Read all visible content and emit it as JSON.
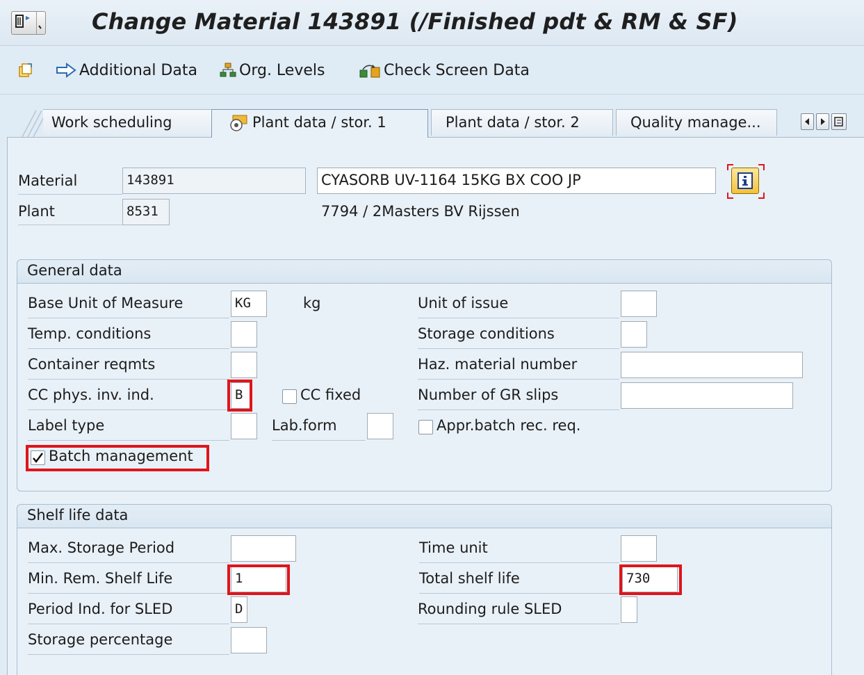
{
  "window": {
    "title": "Change Material 143891 (/Finished pdt & RM & SF)"
  },
  "toolbar": {
    "additional_data": "Additional Data",
    "org_levels": "Org. Levels",
    "check_screen_data": "Check Screen Data"
  },
  "tabs": [
    {
      "label": "Work scheduling",
      "active": false
    },
    {
      "label": "Plant data / stor. 1",
      "active": true
    },
    {
      "label": "Plant data / stor. 2",
      "active": false
    },
    {
      "label": "Quality manage...",
      "active": false
    }
  ],
  "header": {
    "material_label": "Material",
    "material_value": "143891",
    "material_description": "CYASORB UV-1164 15KG BX COO JP",
    "plant_label": "Plant",
    "plant_value": "8531",
    "plant_description": "7794 / 2Masters BV Rijssen"
  },
  "general_data": {
    "title": "General data",
    "base_uom_label": "Base Unit of Measure",
    "base_uom_value": "KG",
    "base_uom_text": "kg",
    "unit_of_issue_label": "Unit of issue",
    "unit_of_issue_value": "",
    "temp_conditions_label": "Temp. conditions",
    "temp_conditions_value": "",
    "storage_conditions_label": "Storage conditions",
    "storage_conditions_value": "",
    "container_reqmts_label": "Container reqmts",
    "container_reqmts_value": "",
    "haz_material_label": "Haz. material number",
    "haz_material_value": "",
    "cc_phys_inv_label": "CC phys. inv. ind.",
    "cc_phys_inv_value": "B",
    "cc_fixed_label": "CC fixed",
    "cc_fixed_checked": false,
    "gr_slips_label": "Number of GR slips",
    "gr_slips_value": "",
    "label_type_label": "Label type",
    "label_type_value": "",
    "lab_form_label": "Lab.form",
    "lab_form_value": "",
    "appr_batch_label": "Appr.batch rec. req.",
    "appr_batch_checked": false,
    "batch_mgmt_label": "Batch management",
    "batch_mgmt_checked": true
  },
  "shelf_life": {
    "title": "Shelf life data",
    "max_storage_label": "Max. Storage Period",
    "max_storage_value": "",
    "time_unit_label": "Time unit",
    "time_unit_value": "",
    "min_rem_label": "Min. Rem. Shelf Life",
    "min_rem_value": "1",
    "total_shelf_label": "Total shelf life",
    "total_shelf_value": "730",
    "period_ind_label": "Period Ind. for SLED",
    "period_ind_value": "D",
    "rounding_label": "Rounding rule SLED",
    "rounding_value": "",
    "storage_pct_label": "Storage percentage",
    "storage_pct_value": ""
  },
  "colors": {
    "highlight": "#e0141b",
    "background": "#dfebf5",
    "panel": "#e9f1f8"
  }
}
